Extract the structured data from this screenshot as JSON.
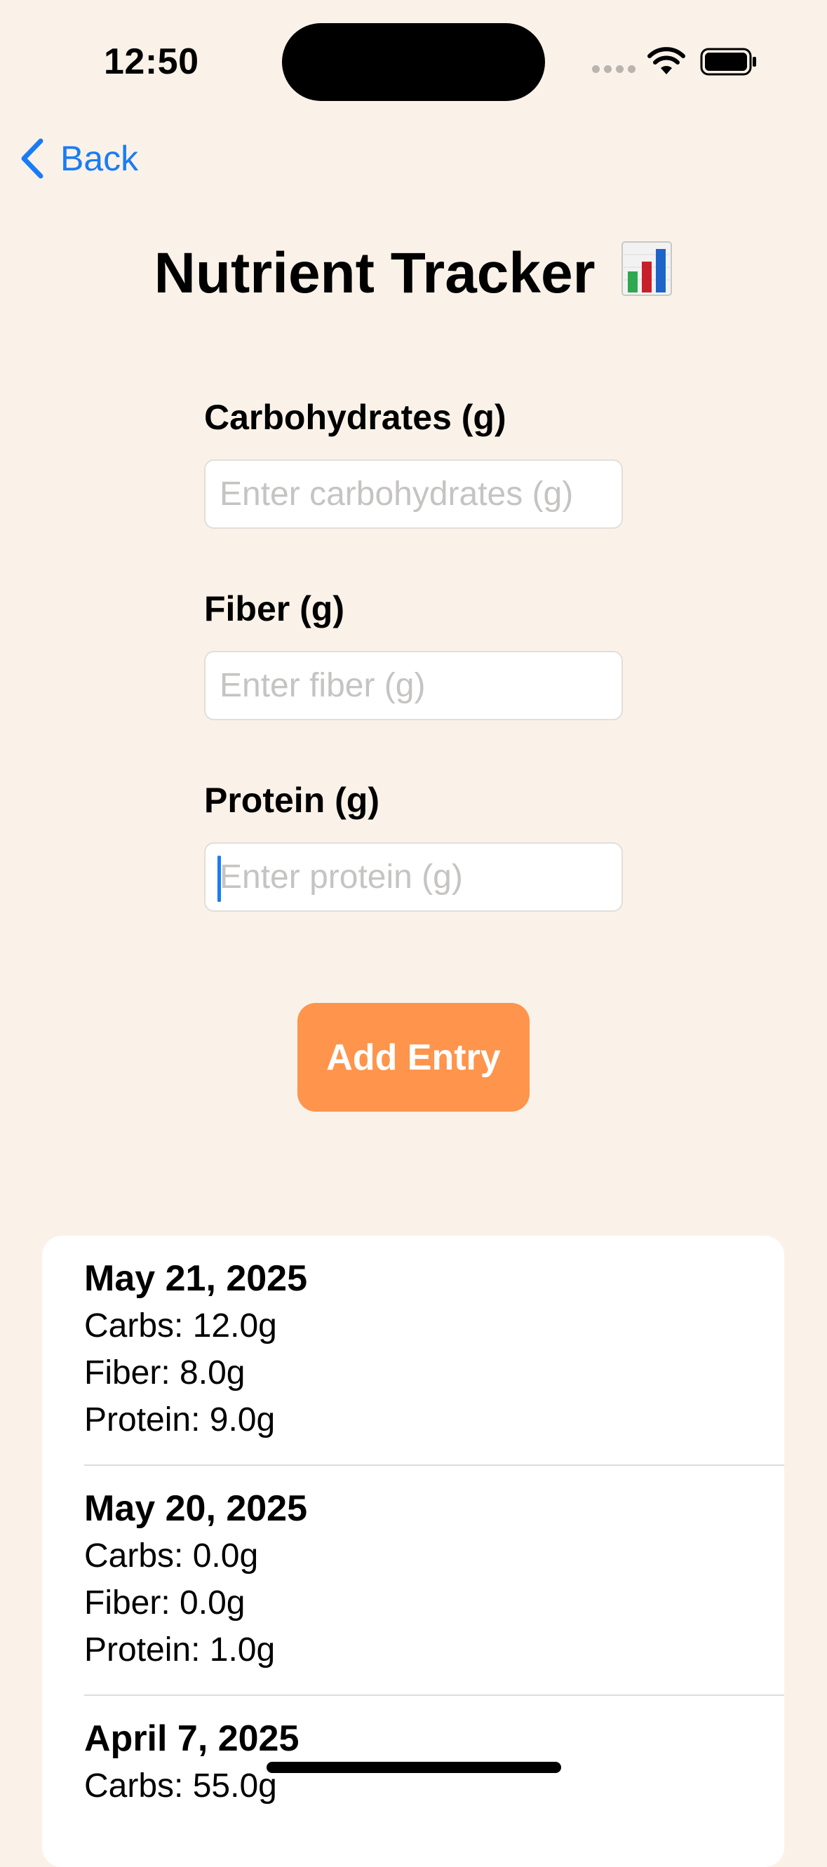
{
  "status_bar": {
    "time": "12:50"
  },
  "nav": {
    "back_label": "Back"
  },
  "title": "Nutrient Tracker",
  "title_icon": "bar-chart-emoji",
  "form": {
    "fields": [
      {
        "label": "Carbohydrates (g)",
        "placeholder": "Enter carbohydrates (g)",
        "value": ""
      },
      {
        "label": "Fiber (g)",
        "placeholder": "Enter fiber (g)",
        "value": ""
      },
      {
        "label": "Protein (g)",
        "placeholder": "Enter protein (g)",
        "value": ""
      }
    ],
    "submit_label": "Add Entry"
  },
  "entries": [
    {
      "date": "May 21, 2025",
      "carbs": "Carbs: 12.0g",
      "fiber": "Fiber: 8.0g",
      "protein": "Protein: 9.0g"
    },
    {
      "date": "May 20, 2025",
      "carbs": "Carbs: 0.0g",
      "fiber": "Fiber: 0.0g",
      "protein": "Protein: 1.0g"
    },
    {
      "date": "April 7, 2025",
      "carbs": "Carbs: 55.0g"
    }
  ],
  "colors": {
    "background": "#faf2e8",
    "accent": "#1a7cf5",
    "button": "#ff944c"
  }
}
